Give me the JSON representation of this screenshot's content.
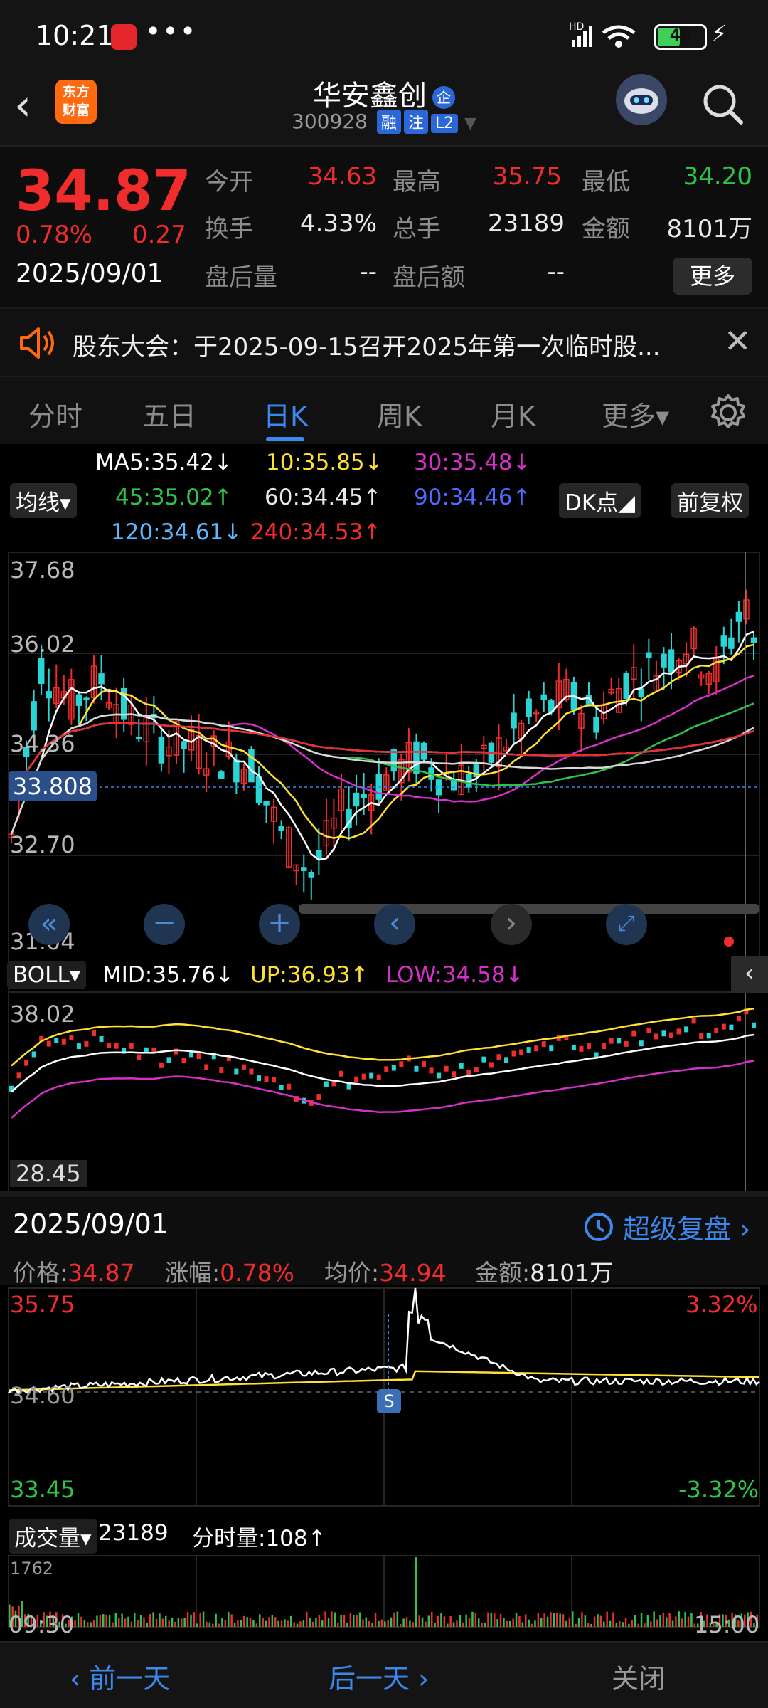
{
  "status": {
    "time": "10:21",
    "dots": "•••",
    "network": "HD",
    "battery": "48",
    "bolt": "⚡"
  },
  "header": {
    "back": "‹",
    "logo_line1": "东方",
    "logo_line2": "财富",
    "name": "华安鑫创",
    "name_badge": "企",
    "code": "300928",
    "tags": [
      "融",
      "注",
      "L2"
    ]
  },
  "quote": {
    "price": "34.87",
    "change_pct": "0.78%",
    "change": "0.27",
    "date": "2025/09/01",
    "fields": [
      {
        "label": "今开",
        "value": "34.63",
        "color": "red"
      },
      {
        "label": "最高",
        "value": "35.75",
        "color": "red"
      },
      {
        "label": "最低",
        "value": "34.20",
        "color": "green"
      },
      {
        "label": "换手",
        "value": "4.33%",
        "color": "white"
      },
      {
        "label": "总手",
        "value": "23189",
        "color": "white"
      },
      {
        "label": "金额",
        "value": "8101万",
        "color": "white"
      },
      {
        "label": "盘后量",
        "value": "--",
        "color": "white"
      },
      {
        "label": "盘后额",
        "value": "--",
        "color": "white"
      }
    ],
    "more": "更多"
  },
  "notice": {
    "text": "股东大会：于2025-09-15召开2025年第一次临时股...",
    "close": "✕"
  },
  "tabs": [
    "分时",
    "五日",
    "日K",
    "周K",
    "月K",
    "更多▾"
  ],
  "active_tab": 2,
  "ma": {
    "selector": "均线▾",
    "dk": "DK点◢",
    "fq": "前复权",
    "items": [
      {
        "text": "MA5:35.42↓",
        "color": "#ffffff"
      },
      {
        "text": "10:35.85↓",
        "color": "#ffe033"
      },
      {
        "text": "30:35.48↓",
        "color": "#d530c8"
      },
      {
        "text": "45:35.02↑",
        "color": "#2ec44a"
      },
      {
        "text": "60:34.45↑",
        "color": "#e8e8e8"
      },
      {
        "text": "90:34.46↑",
        "color": "#4c6bff"
      },
      {
        "text": "120:34.61↓",
        "color": "#5bb8ff"
      },
      {
        "text": "240:34.53↑",
        "color": "#f02c2c"
      }
    ]
  },
  "kchart": {
    "y_labels": [
      "37.68",
      "36.02",
      "34.36",
      "32.70",
      "31.04"
    ],
    "current_label": "33.808",
    "y_range": [
      31.04,
      37.68
    ]
  },
  "boll": {
    "label": "BOLL▾",
    "mid": "MID:35.76↓",
    "up": "UP:36.93↑",
    "low": "LOW:34.58↓",
    "y_top": "38.02",
    "y_bottom": "28.45"
  },
  "intraday": {
    "date": "2025/09/01",
    "replay": "超级复盘 ›",
    "price_label": "价格:",
    "price": "34.87",
    "chg_label": "涨幅:",
    "chg": "0.78%",
    "avg_label": "均价:",
    "avg": "34.94",
    "amt_label": "金额:",
    "amt": "8101万",
    "y_high": "35.75",
    "y_mid": "34.60",
    "y_low": "33.45",
    "pct_high": "3.32%",
    "pct_low": "-3.32%",
    "s_marker": "S"
  },
  "volume": {
    "label": "成交量▾",
    "total": "23189",
    "tick_label": "分时量:108↑",
    "max": "1762",
    "t_start": "09:30",
    "t_end": "15:00"
  },
  "footer": {
    "prev": "‹ 前一天",
    "next": "后一天 ›",
    "close": "关闭"
  }
}
